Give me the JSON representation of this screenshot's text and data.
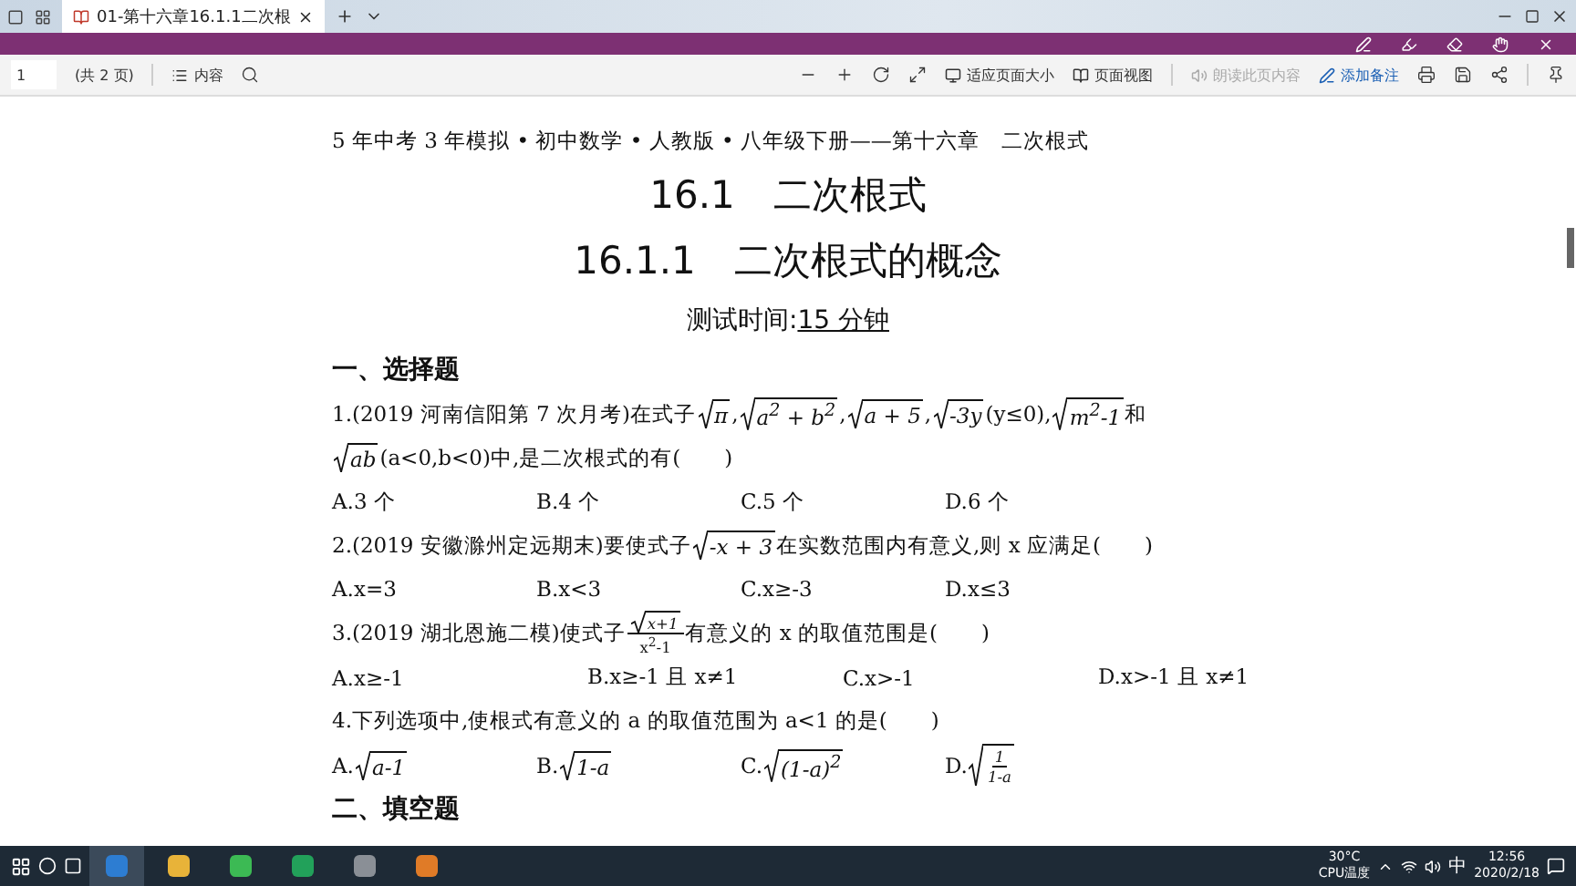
{
  "browser": {
    "tabs": [
      {
        "title": "01-第十六章16.1.1二次根",
        "selected": true
      }
    ]
  },
  "toolbar": {
    "page": "1",
    "page_count": "(共 2 页)",
    "contents": "内容",
    "fit_page": "适应页面大小",
    "page_view": "页面视图",
    "read_aloud": {
      "label": "朗读此页内容",
      "disabled": true
    },
    "add_note": "添加备注"
  },
  "document": {
    "header": "5 年中考 3 年模拟 • 初中数学 • 人教版 • 八年级下册——第十六章　二次根式",
    "title": "16.1　二次根式",
    "subtitle": "16.1.1　二次根式的概念",
    "time_label": "测试时间:",
    "time_value": "15 分钟",
    "sections": [
      {
        "title": "一、选择题",
        "questions": [
          {
            "stem": [
              [
                {
                  "kind": "text",
                  "text": "1.(2019 河南信阳第 7 次月考)在式子"
                },
                {
                  "kind": "sqrt",
                  "body": [
                    {
                      "kind": "text",
                      "text": "π"
                    }
                  ]
                },
                {
                  "kind": "text",
                  "text": ","
                },
                {
                  "kind": "sqrt",
                  "body": [
                    {
                      "kind": "text",
                      "text": "a$^{2}$ + b$^{2}$"
                    }
                  ]
                },
                {
                  "kind": "text",
                  "text": ","
                },
                {
                  "kind": "sqrt",
                  "body": [
                    {
                      "kind": "text",
                      "text": "a + 5"
                    }
                  ]
                },
                {
                  "kind": "text",
                  "text": ","
                },
                {
                  "kind": "sqrt",
                  "body": [
                    {
                      "kind": "text",
                      "text": "-3y"
                    }
                  ]
                },
                {
                  "kind": "text",
                  "text": "(y≤0),"
                },
                {
                  "kind": "sqrt",
                  "body": [
                    {
                      "kind": "text",
                      "text": "m$^{2}$-1"
                    }
                  ]
                },
                {
                  "kind": "text",
                  "text": "和"
                }
              ],
              [
                {
                  "kind": "sqrt",
                  "body": [
                    {
                      "kind": "text",
                      "text": "ab"
                    }
                  ]
                },
                {
                  "kind": "text",
                  "text": "(a<0,b<0)中,是二次根式的有(　　)"
                }
              ]
            ],
            "options": [
              [
                {
                  "kind": "text",
                  "text": "A.3 个"
                }
              ],
              [
                {
                  "kind": "text",
                  "text": "B.4 个"
                }
              ],
              [
                {
                  "kind": "text",
                  "text": "C.5 个"
                }
              ],
              [
                {
                  "kind": "text",
                  "text": "D.6 个"
                }
              ]
            ]
          },
          {
            "stem": [
              [
                {
                  "kind": "text",
                  "text": "2.(2019 安徽滁州定远期末)要使式子"
                },
                {
                  "kind": "sqrt",
                  "body": [
                    {
                      "kind": "text",
                      "text": "-x + 3"
                    }
                  ]
                },
                {
                  "kind": "text",
                  "text": "在实数范围内有意义,则 x 应满足(　　)"
                }
              ]
            ],
            "options": [
              [
                {
                  "kind": "text",
                  "text": "A.x=3"
                }
              ],
              [
                {
                  "kind": "text",
                  "text": "B.x<3"
                }
              ],
              [
                {
                  "kind": "text",
                  "text": "C.x≥-3"
                }
              ],
              [
                {
                  "kind": "text",
                  "text": "D.x≤3"
                }
              ]
            ]
          },
          {
            "stem": [
              [
                {
                  "kind": "text",
                  "text": "3.(2019 湖北恩施二模)使式子"
                },
                {
                  "kind": "frac",
                  "num": [
                    {
                      "kind": "sqrt",
                      "body": [
                        {
                          "kind": "text",
                          "text": "x+1"
                        }
                      ]
                    }
                  ],
                  "den": [
                    {
                      "kind": "text",
                      "text": "x$^{2}$-1"
                    }
                  ]
                },
                {
                  "kind": "text",
                  "text": "有意义的 x 的取值范围是(　　)"
                }
              ]
            ],
            "options": [
              [
                {
                  "kind": "text",
                  "text": "A.x≥-1"
                }
              ],
              [
                {
                  "kind": "text",
                  "text": "B.x≥-1 且 x≠1"
                }
              ],
              [
                {
                  "kind": "text",
                  "text": "C.x>-1"
                }
              ],
              [
                {
                  "kind": "text",
                  "text": "D.x>-1 且 x≠1"
                }
              ]
            ]
          },
          {
            "stem": [
              [
                {
                  "kind": "text",
                  "text": "4.下列选项中,使根式有意义的 a 的取值范围为 a<1 的是(　　)"
                }
              ]
            ],
            "options": [
              [
                {
                  "kind": "text",
                  "text": "A."
                },
                {
                  "kind": "sqrt",
                  "body": [
                    {
                      "kind": "text",
                      "text": "a-1"
                    }
                  ]
                }
              ],
              [
                {
                  "kind": "text",
                  "text": "B."
                },
                {
                  "kind": "sqrt",
                  "body": [
                    {
                      "kind": "text",
                      "text": "1-a"
                    }
                  ]
                }
              ],
              [
                {
                  "kind": "text",
                  "text": "C."
                },
                {
                  "kind": "sqrt",
                  "body": [
                    {
                      "kind": "text",
                      "text": "(1-a)$^{2}$"
                    }
                  ]
                }
              ],
              [
                {
                  "kind": "text",
                  "text": "D."
                },
                {
                  "kind": "sqrt",
                  "body": [
                    {
                      "kind": "frac",
                      "num": [
                        {
                          "kind": "text",
                          "text": "1"
                        }
                      ],
                      "den": [
                        {
                          "kind": "text",
                          "text": "1-a"
                        }
                      ]
                    }
                  ]
                }
              ]
            ]
          }
        ]
      },
      {
        "title": "二、填空题"
      }
    ]
  },
  "taskbar": {
    "apps": [
      {
        "color": "#2d7dd2",
        "selected": true
      },
      {
        "color": "#e8b339",
        "selected": false
      },
      {
        "color": "#3cba54",
        "selected": false
      },
      {
        "color": "#22a15a",
        "selected": false
      },
      {
        "color": "#8a8f96",
        "selected": false
      },
      {
        "color": "#e07b27",
        "selected": false
      }
    ],
    "temperature": "30°C",
    "temperature_label": "CPU温度",
    "ime": "中",
    "time": "12:56",
    "date": "2020/2/18"
  }
}
